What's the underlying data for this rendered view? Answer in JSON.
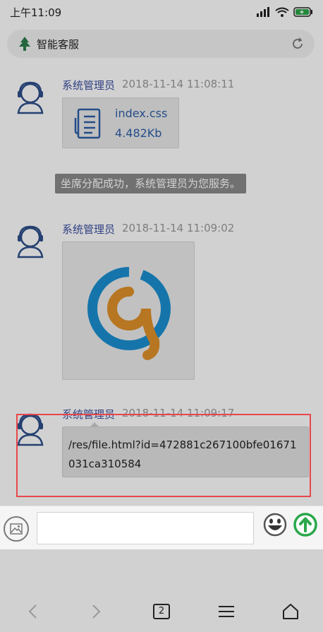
{
  "status_bar": {
    "time": "上午11:09"
  },
  "header": {
    "title": "智能客服"
  },
  "messages": [
    {
      "sender": "系统管理员",
      "time": "2018-11-14 11:08:11",
      "file_name": "index.css",
      "file_size": "4.482Kb"
    },
    {
      "system_notice": "坐席分配成功，系统管理员为您服务。"
    },
    {
      "sender": "系统管理员",
      "time": "2018-11-14 11:09:02"
    },
    {
      "sender": "系统管理员",
      "time": "2018-11-14 11:09:17",
      "text": "/res/file.html?id=472881c267100bfe01671031ca310584"
    }
  ],
  "composer": {
    "input_value": "",
    "placeholder": ""
  },
  "browser_nav": {
    "tab_count": "2"
  },
  "colors": {
    "sender_name": "#3b4fa0",
    "link_text": "#2d5fa8",
    "highlight_border": "#e8464b",
    "send_button": "#2aa84a",
    "logo_blue": "#1a8fd1",
    "logo_orange": "#e0912a"
  },
  "icons": [
    "tree-logo-icon",
    "refresh-icon",
    "agent-avatar-icon",
    "file-icon",
    "image-picker-icon",
    "emoji-icon",
    "send-arrow-icon",
    "back-icon",
    "forward-icon",
    "menu-icon",
    "home-icon"
  ]
}
